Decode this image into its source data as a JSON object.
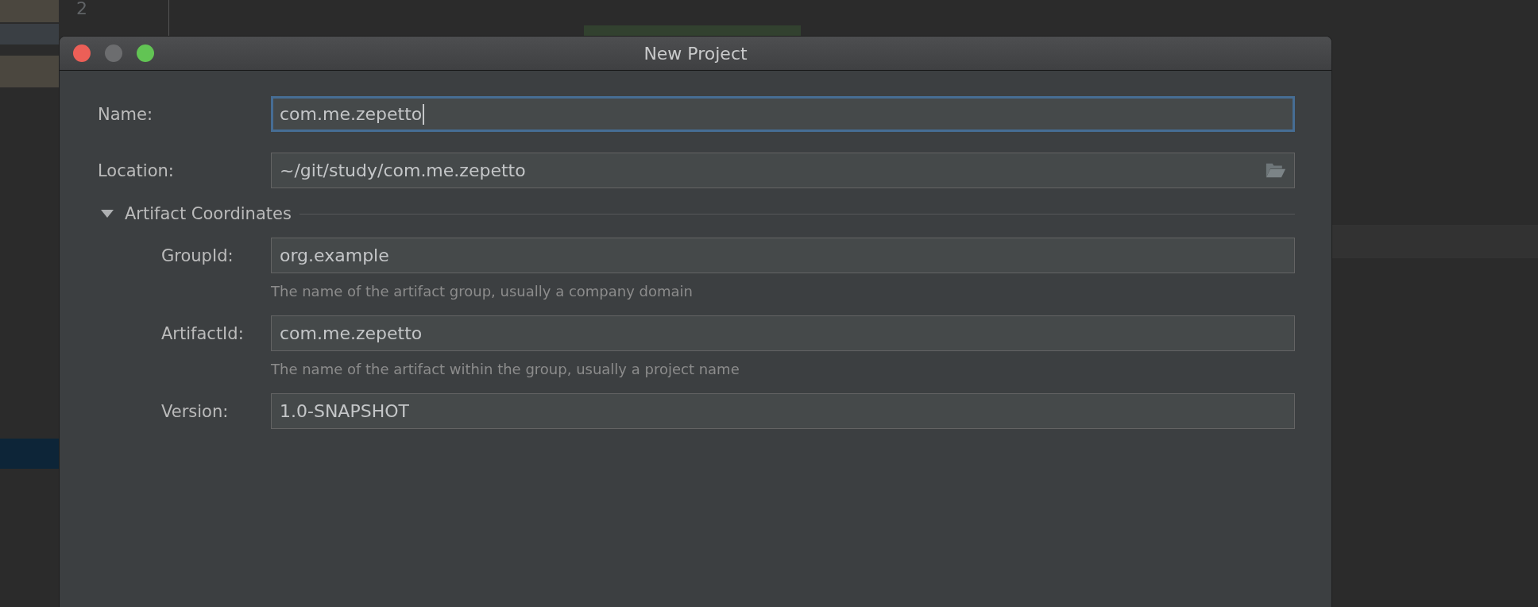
{
  "editor": {
    "line_numbers": [
      "2"
    ]
  },
  "dialog": {
    "title": "New Project",
    "fields": [
      {
        "label": "Name:",
        "value": "com.me.zepetto",
        "kind": "text",
        "focused": true
      },
      {
        "label": "Location:",
        "value": "~/git/study/com.me.zepetto",
        "kind": "path",
        "focused": false
      }
    ],
    "section": {
      "title": "Artifact Coordinates",
      "expanded": true,
      "fields": [
        {
          "label": "GroupId:",
          "value": "org.example",
          "hint": "The name of the artifact group, usually a company domain",
          "focused": false
        },
        {
          "label": "ArtifactId:",
          "value": "com.me.zepetto",
          "hint": "The name of the artifact within the group, usually a project name",
          "focused": false
        },
        {
          "label": "Version:",
          "value": "1.0-SNAPSHOT",
          "focused": false
        }
      ]
    }
  }
}
